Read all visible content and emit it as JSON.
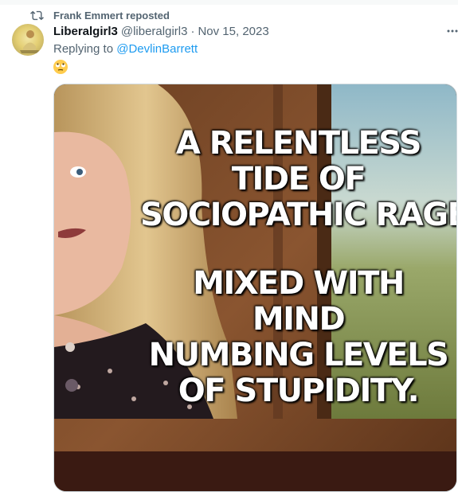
{
  "repost": {
    "label": "Frank Emmert reposted",
    "icon": "repost-icon"
  },
  "tweet": {
    "author_name": "Liberalgirl3",
    "author_handle": "@liberalgirl3",
    "separator": "·",
    "date": "Nov 15, 2023",
    "reply_prefix": "Replying to",
    "reply_to": "@DevlinBarrett",
    "emoji": "face-with-rolling-eyes",
    "more_icon": "more-icon"
  },
  "media": {
    "meme_top": [
      "A RELENTLESS",
      "TIDE OF",
      "SOCIOPATHIC RAGE"
    ],
    "meme_bottom": [
      "MIXED WITH",
      "MIND",
      "NUMBING LEVELS",
      "OF STUPIDITY."
    ]
  },
  "colors": {
    "secondary_text": "#536471",
    "link": "#1d9bf0",
    "border": "#cfd9de"
  }
}
